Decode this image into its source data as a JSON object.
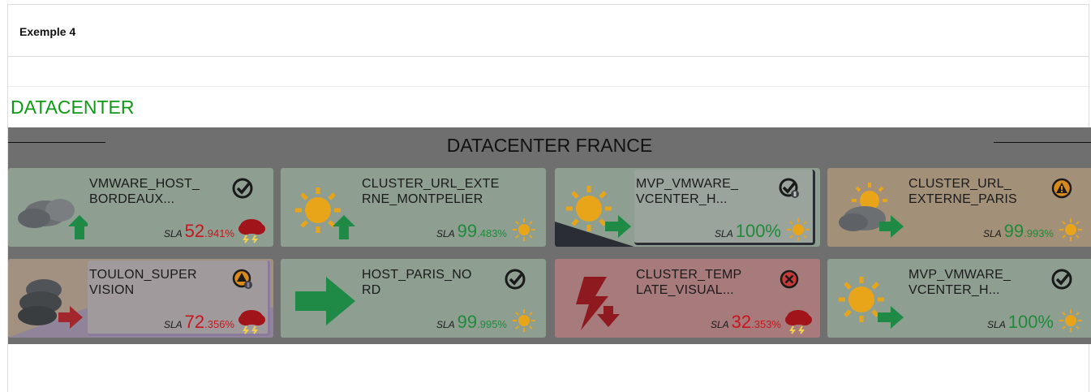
{
  "panel": {
    "title": "Exemple 4"
  },
  "section": {
    "title": "DATACENTER"
  },
  "board": {
    "title": "DATACENTER FRANCE",
    "tiles": [
      {
        "name": "VMWARE_HOST_\nBORDEAUX...",
        "sla_int": "52",
        "sla_dec": ".941%",
        "sla_label": "SLA",
        "color": "green",
        "weather": "storm-icon",
        "status": "check-icon"
      },
      {
        "name": "CLUSTER_URL_EXTE\nRNE_MONTPELIER",
        "sla_int": "99",
        "sla_dec": ".483%",
        "sla_label": "SLA",
        "color": "green",
        "weather": "sun-icon",
        "status": ""
      },
      {
        "name": "MVP_VMWARE_\nVCENTER_H...",
        "sla_int": "100%",
        "sla_dec": "",
        "sla_label": "SLA",
        "color": "green",
        "weather": "sun-icon",
        "status": "check-maintenance-icon"
      },
      {
        "name": "CLUSTER_URL_\nEXTERNE_PARIS",
        "sla_int": "99",
        "sla_dec": ".993%",
        "sla_label": "SLA",
        "color": "orange",
        "weather": "sun-icon",
        "status": "warning-icon"
      },
      {
        "name": "TOULON_SUPER\nVISION",
        "sla_int": "72",
        "sla_dec": ".356%",
        "sla_label": "SLA",
        "color": "mixed",
        "weather": "storm-icon",
        "status": "warning-maintenance-icon"
      },
      {
        "name": "HOST_PARIS_NO\nRD",
        "sla_int": "99",
        "sla_dec": ".995%",
        "sla_label": "SLA",
        "color": "green",
        "weather": "sun-icon",
        "status": "check-icon"
      },
      {
        "name": "CLUSTER_TEMP\nLATE_VISUAL...",
        "sla_int": "32",
        "sla_dec": ".353%",
        "sla_label": "SLA",
        "color": "red",
        "weather": "storm-icon",
        "status": "error-icon"
      },
      {
        "name": "MVP_VMWARE_\nVCENTER_H...",
        "sla_int": "100%",
        "sla_dec": "",
        "sla_label": "SLA",
        "color": "green",
        "weather": "sun-icon",
        "status": "check-icon"
      }
    ]
  }
}
